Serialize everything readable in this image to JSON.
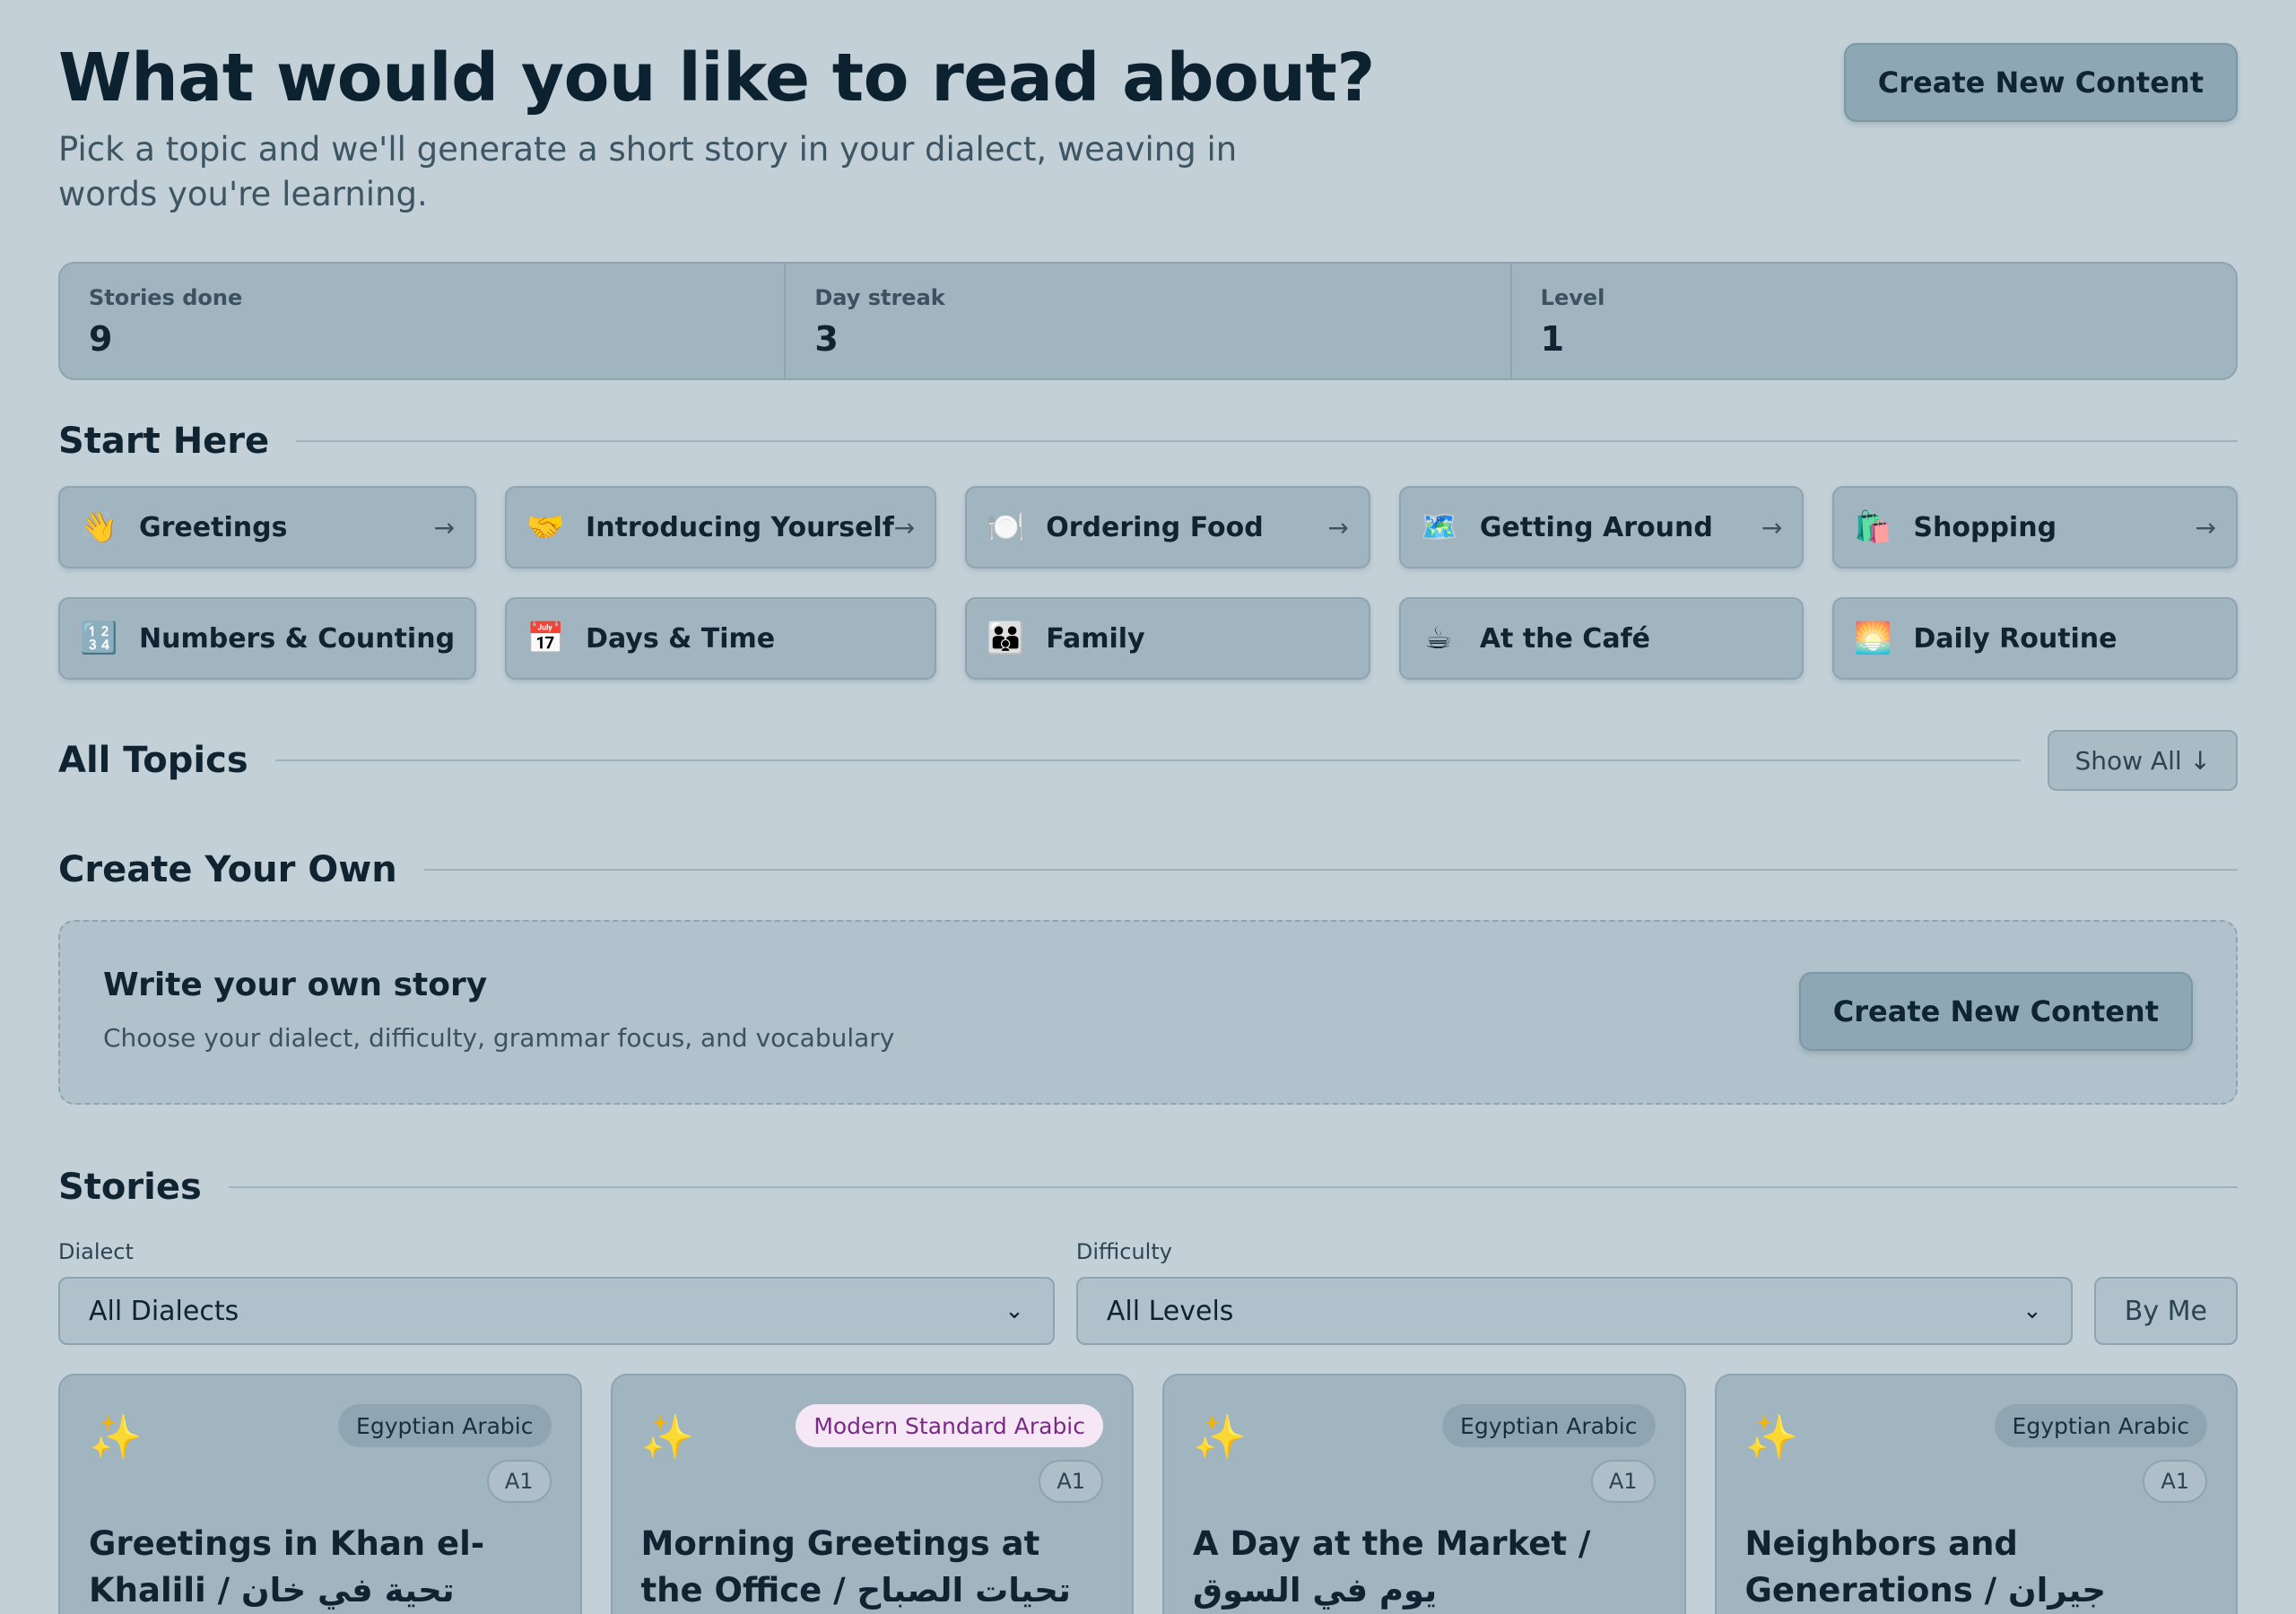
{
  "header": {
    "title": "What would you like to read about?",
    "subtitle": "Pick a topic and we'll generate a short story in your dialect, weaving in words you're learning.",
    "create_button": "Create New Content"
  },
  "stats": [
    {
      "label": "Stories done",
      "value": "9"
    },
    {
      "label": "Day streak",
      "value": "3"
    },
    {
      "label": "Level",
      "value": "1"
    }
  ],
  "start_here": {
    "title": "Start Here",
    "topics": [
      {
        "emoji": "👋",
        "label": "Greetings",
        "arrow": "→"
      },
      {
        "emoji": "🤝",
        "label": "Introducing Yourself",
        "arrow": "→"
      },
      {
        "emoji": "🍽️",
        "label": "Ordering Food",
        "arrow": "→"
      },
      {
        "emoji": "🗺️",
        "label": "Getting Around",
        "arrow": "→"
      },
      {
        "emoji": "🛍️",
        "label": "Shopping",
        "arrow": "→"
      },
      {
        "emoji": "🔢",
        "label": "Numbers & Counting",
        "arrow": ""
      },
      {
        "emoji": "📅",
        "label": "Days & Time",
        "arrow": ""
      },
      {
        "emoji": "👪",
        "label": "Family",
        "arrow": ""
      },
      {
        "emoji": "☕",
        "label": "At the Café",
        "arrow": ""
      },
      {
        "emoji": "🌅",
        "label": "Daily Routine",
        "arrow": ""
      }
    ]
  },
  "all_topics": {
    "title": "All Topics",
    "show_all": "Show All ↓"
  },
  "create_own": {
    "title": "Create Your Own",
    "box_title": "Write your own story",
    "box_desc": "Choose your dialect, difficulty, grammar focus, and vocabulary",
    "button": "Create New Content"
  },
  "stories": {
    "title": "Stories",
    "filters": {
      "dialect_label": "Dialect",
      "dialect_value": "All Dialects",
      "difficulty_label": "Difficulty",
      "difficulty_value": "All Levels",
      "by_me": "By Me"
    },
    "cards": [
      {
        "dialect": "Egyptian Arabic",
        "level": "A1",
        "title": "Greetings in Khan el-Khalili / تحية في خان الخليلي"
      },
      {
        "dialect": "Modern Standard Arabic",
        "level": "A1",
        "title": "Morning Greetings at the Office / تحيات الصباح في..."
      },
      {
        "dialect": "Egyptian Arabic",
        "level": "A1",
        "title": "A Day at the Market / يوم في السوق"
      },
      {
        "dialect": "Egyptian Arabic",
        "level": "A1",
        "title": "Neighbors and Generations / جيران وأجيال"
      }
    ]
  }
}
